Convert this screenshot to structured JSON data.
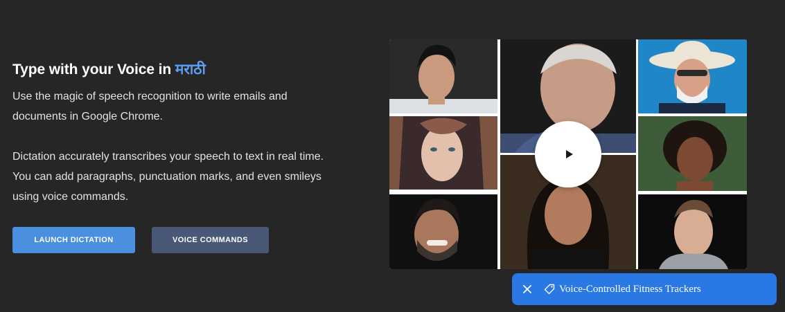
{
  "hero": {
    "headline_prefix": "Type with your Voice in ",
    "headline_language": "मराठी",
    "paragraph_1": "Use the magic of speech recognition to write emails and documents in Google Chrome.",
    "paragraph_2": "Dictation accurately transcribes your speech to text in real time. You can add paragraphs, punctuation marks, and even smileys using voice commands."
  },
  "buttons": {
    "launch_label": "LAUNCH DICTATION",
    "commands_label": "VOICE COMMANDS"
  },
  "video": {
    "play_icon": "play-icon",
    "tiles": [
      "portrait-young-man",
      "portrait-elderly-man",
      "portrait-man-cowboy-hat",
      "portrait-woman-headscarf",
      "portrait-woman-curly-hair",
      "portrait-bearded-man-smiling",
      "portrait-woman-dark-hair",
      "portrait-man-hoodie"
    ]
  },
  "toast": {
    "close_icon": "close-icon",
    "tag_icon": "tag-icon",
    "label": "Voice-Controlled Fitness Trackers"
  },
  "colors": {
    "background": "#262627",
    "accent": "#5c9ff0",
    "launch_button": "#4a8fe0",
    "commands_button": "#4a5877",
    "toast": "#2a78e4"
  }
}
